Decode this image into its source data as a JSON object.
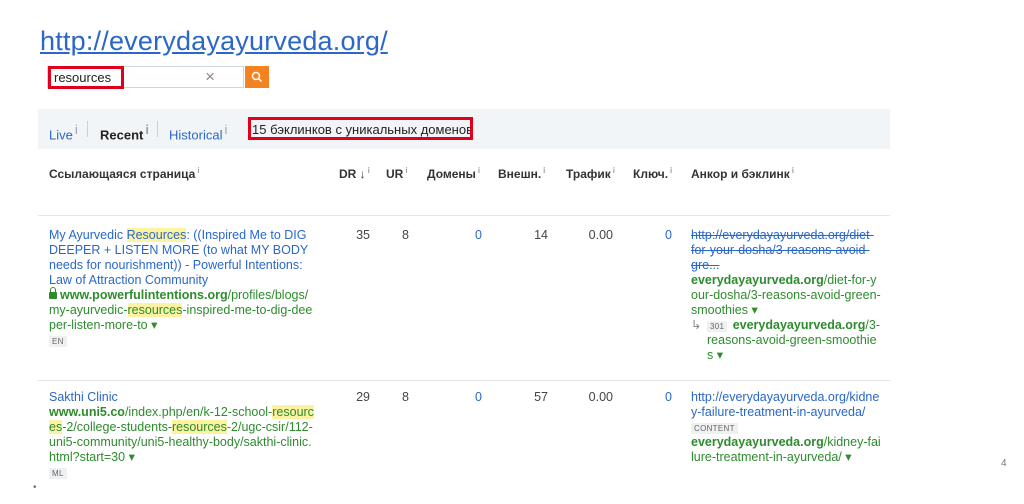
{
  "site_url": "http://everydayayurveda.org/",
  "search": {
    "value": "resources",
    "clear_icon": "×",
    "button_icon": "search-icon"
  },
  "tabs": {
    "live": "Live",
    "recent": "Recent",
    "historical": "Historical",
    "info": "i",
    "summary": "15 бэклинков с уникальных доменов"
  },
  "columns": {
    "page": "Ссылающаяся страница",
    "dr": "DR ↓",
    "ur": "UR",
    "domains": "Домены",
    "external": "Внешн.",
    "traffic": "Трафик",
    "keywords": "Ключ.",
    "anchor": "Анкор и бэклинк",
    "info": "i"
  },
  "rows": [
    {
      "title_lines": [
        "My Ayurvedic ",
        "Resources",
        ": ((Inspired Me to DIG",
        "DEEPER + LISTEN MORE (to what MY BODY",
        "needs for nourishment)) - Powerful Intentions:",
        "Law of Attraction Community"
      ],
      "url_domain": "www.powerfulintentions.org",
      "url_path_1": "/profiles/blogs/",
      "url_path_2a": "my-ayurvedic-",
      "url_path_2b": "resources",
      "url_path_2c": "-inspired-me-to-dig-dee",
      "url_path_3": "per-listen-more-to",
      "lang": "EN",
      "dr": "35",
      "ur": "8",
      "domains": "0",
      "external": "14",
      "traffic": "0.00",
      "keywords": "0",
      "anchor_old": [
        "http://everydayayurveda.org/diet-",
        "for-your-dosha/3-reasons-avoid-",
        "gre..."
      ],
      "anchor_new_domain": "everydayayurveda.org",
      "anchor_new_path": [
        "/diet-for-y",
        "our-dosha/3-reasons-avoid-green-",
        "smoothies"
      ],
      "redirect_code": "301",
      "redirect_domain": "everydayayurveda.org",
      "redirect_path": [
        "/3-",
        "reasons-avoid-green-smoothie",
        "s"
      ]
    },
    {
      "title": "Sakthi Clinic",
      "url_domain": "www.uni5.co",
      "url_path_1": "/index.php/en/k-12-school-",
      "url_hl_1": "resourc",
      "url_path_2a": "es",
      "url_path_2b": "-2/college-students-",
      "url_hl_2": "resources",
      "url_path_2c": "-2/ugc-csir/112-",
      "url_path_3": "uni5-community/uni5-healthy-body/sakthi-clinic.",
      "url_path_4": "html?start=30",
      "lang": "ML",
      "dr": "29",
      "ur": "8",
      "domains": "0",
      "external": "57",
      "traffic": "0.00",
      "keywords": "0",
      "anchor_url": [
        "http://everydayayurveda.org/kidne",
        "y-failure-treatment-in-ayurveda/"
      ],
      "anchor_tag": "CONTENT",
      "anchor_domain": "everydayayurveda.org",
      "anchor_path": [
        "/kidney-fai",
        "lure-treatment-in-ayurveda/"
      ]
    }
  ],
  "page_marker": "4",
  "bullet": "•"
}
